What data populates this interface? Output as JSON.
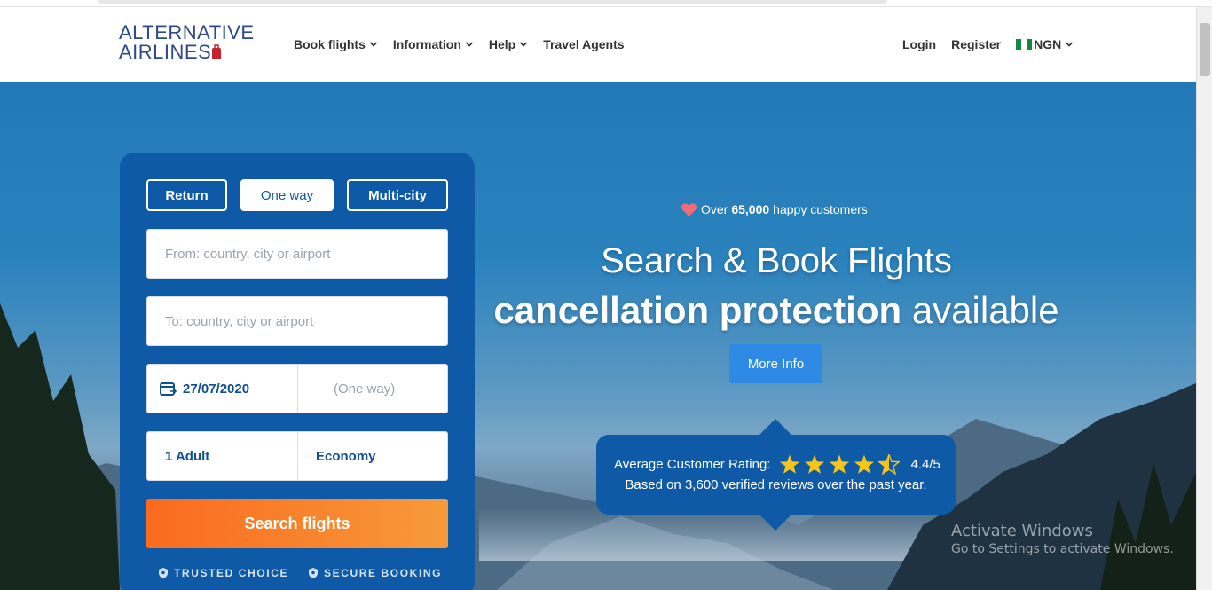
{
  "brand": {
    "line1": "ALTERNATIVE",
    "line2": "AIRLINES"
  },
  "nav": {
    "items": [
      {
        "label": "Book flights",
        "dropdown": true
      },
      {
        "label": "Information",
        "dropdown": true
      },
      {
        "label": "Help",
        "dropdown": true
      },
      {
        "label": "Travel Agents",
        "dropdown": false
      }
    ],
    "login": "Login",
    "register": "Register",
    "currency": "NGN"
  },
  "search": {
    "trip_types": [
      "Return",
      "One way",
      "Multi-city"
    ],
    "selected_trip_type": "One way",
    "from_placeholder": "From: country, city or airport",
    "to_placeholder": "To: country, city or airport",
    "depart_date": "27/07/2020",
    "return_date": "(One way)",
    "passengers": "1 Adult",
    "cabin_class": "Economy",
    "submit_label": "Search flights",
    "trust_badges": [
      "TRUSTED CHOICE",
      "SECURE BOOKING"
    ]
  },
  "hero": {
    "happy_prefix": "Over",
    "happy_count": "65,000",
    "happy_suffix": "happy customers",
    "headline_line1": "Search & Book Flights",
    "headline_bold": "cancellation protection",
    "headline_rest": "available",
    "more_info_label": "More Info"
  },
  "rating": {
    "label": "Average Customer Rating:",
    "stars_value": 4.4,
    "score_text": "4.4/5",
    "subtext": "Based on 3,600 verified reviews over the past year."
  },
  "watermark": {
    "line1": "Activate Windows",
    "line2": "Go to Settings to activate Windows."
  },
  "colors": {
    "panel_blue": "#0e5aa7",
    "search_orange": "#fa6a1f",
    "more_info_blue": "#2e8ae4",
    "star_yellow": "#f5c518",
    "heart_pink": "#f06b7c"
  }
}
